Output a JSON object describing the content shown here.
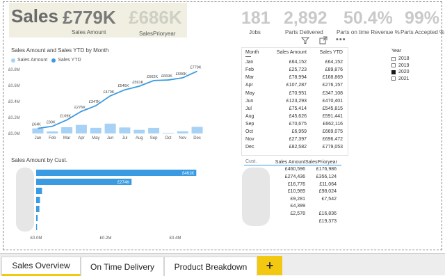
{
  "kpis": {
    "title": "Sales",
    "sales_amount_value": "£779K",
    "sales_amount_label": "Sales Amount",
    "sales_prior_value": "£686K",
    "sales_prior_label": "SalesPrioryear",
    "jobs_value": "181",
    "jobs_label": "Jobs",
    "parts_delivered_value": "2,892",
    "parts_delivered_label": "Parts Delivered",
    "on_time_value": "50.4%",
    "on_time_label": "Parts on time Revenue %",
    "accepted_value": "99%",
    "accepted_label": "Parts Accepted %"
  },
  "line_chart": {
    "title": "Sales Amount and Sales YTD by Month",
    "legend": [
      "Sales Amount",
      "Sales YTD"
    ],
    "y_ticks": [
      "£0.8M",
      "£0.6M",
      "£0.4M",
      "£0.2M",
      "£0.0M"
    ],
    "months": [
      "Jan",
      "Feb",
      "Mar",
      "Apr",
      "May",
      "Jun",
      "Jul",
      "Aug",
      "Sep",
      "Oct",
      "Nov",
      "Dec"
    ],
    "ytd_labels": [
      "£64K",
      "£90K",
      "£169K",
      "£276K",
      "£347K",
      "£470K",
      "£546K",
      "£591K",
      "£662K",
      "£669K",
      "£696K",
      "£779K"
    ]
  },
  "month_table": {
    "headers": [
      "Month",
      "Sales Amount",
      "Sales YTD"
    ],
    "rows": [
      [
        "Jan",
        "£64,152",
        "£64,152"
      ],
      [
        "Feb",
        "£25,723",
        "£89,876"
      ],
      [
        "Mar",
        "£78,994",
        "£168,869"
      ],
      [
        "Apr",
        "£107,287",
        "£276,157"
      ],
      [
        "May",
        "£70,951",
        "£347,108"
      ],
      [
        "Jun",
        "£123,293",
        "£470,401"
      ],
      [
        "Jul",
        "£75,414",
        "£545,815"
      ],
      [
        "Aug",
        "£45,626",
        "£591,441"
      ],
      [
        "Sep",
        "£70,675",
        "£662,116"
      ],
      [
        "Oct",
        "£6,959",
        "£669,075"
      ],
      [
        "Nov",
        "£27,397",
        "£696,472"
      ],
      [
        "Dec",
        "£82,582",
        "£779,053"
      ]
    ]
  },
  "year_slicer": {
    "title": "Year",
    "options": [
      {
        "label": "2018",
        "checked": false
      },
      {
        "label": "2019",
        "checked": false
      },
      {
        "label": "2020",
        "checked": true
      },
      {
        "label": "2021",
        "checked": false
      }
    ]
  },
  "cust_chart": {
    "title": "Sales Amount by Cust.",
    "bar_labels": [
      "£461K",
      "£274K"
    ],
    "x_ticks": [
      "£0.0M",
      "£0.2M",
      "£0.4M"
    ]
  },
  "cust_table": {
    "headers": [
      "Cust.",
      "Sales Amount",
      "SalesPrioryear"
    ],
    "rows": [
      [
        "£460,596",
        "£176,986"
      ],
      [
        "£274,436",
        "£356,124"
      ],
      [
        "£16,776",
        "£11,064"
      ],
      [
        "£10,989",
        "£98,024"
      ],
      [
        "£9,281",
        "£7,542"
      ],
      [
        "£4,399",
        ""
      ],
      [
        "£2,578",
        "£16,836"
      ],
      [
        "",
        "£19,373"
      ]
    ]
  },
  "tabs": [
    "Sales Overview",
    "On Time Delivery",
    "Product Breakdown"
  ],
  "add_tab_label": "+",
  "colors": {
    "bar_light": "#a7d2f5",
    "line_blue": "#3d9ae0",
    "cust_bar": "#3a9be3",
    "tab_accent": "#f2c811"
  },
  "chart_data": [
    {
      "type": "bar",
      "title": "Sales Amount and Sales YTD by Month",
      "categories": [
        "Jan",
        "Feb",
        "Mar",
        "Apr",
        "May",
        "Jun",
        "Jul",
        "Aug",
        "Sep",
        "Oct",
        "Nov",
        "Dec"
      ],
      "series": [
        {
          "name": "Sales Amount",
          "values": [
            64152,
            25723,
            78994,
            107287,
            70951,
            123293,
            75414,
            45626,
            70675,
            6959,
            27397,
            82582
          ]
        },
        {
          "name": "Sales YTD",
          "values": [
            64152,
            89876,
            168869,
            276157,
            347108,
            470401,
            545815,
            591441,
            662116,
            669075,
            696472,
            779053
          ]
        }
      ],
      "ylim": [
        0,
        800000
      ]
    },
    {
      "type": "bar",
      "title": "Sales Amount by Cust.",
      "categories": [
        "",
        ""
      ],
      "values": [
        460596,
        274436,
        16776,
        10989,
        9281,
        4399,
        2578
      ],
      "xlim": [
        0,
        500000
      ]
    }
  ]
}
